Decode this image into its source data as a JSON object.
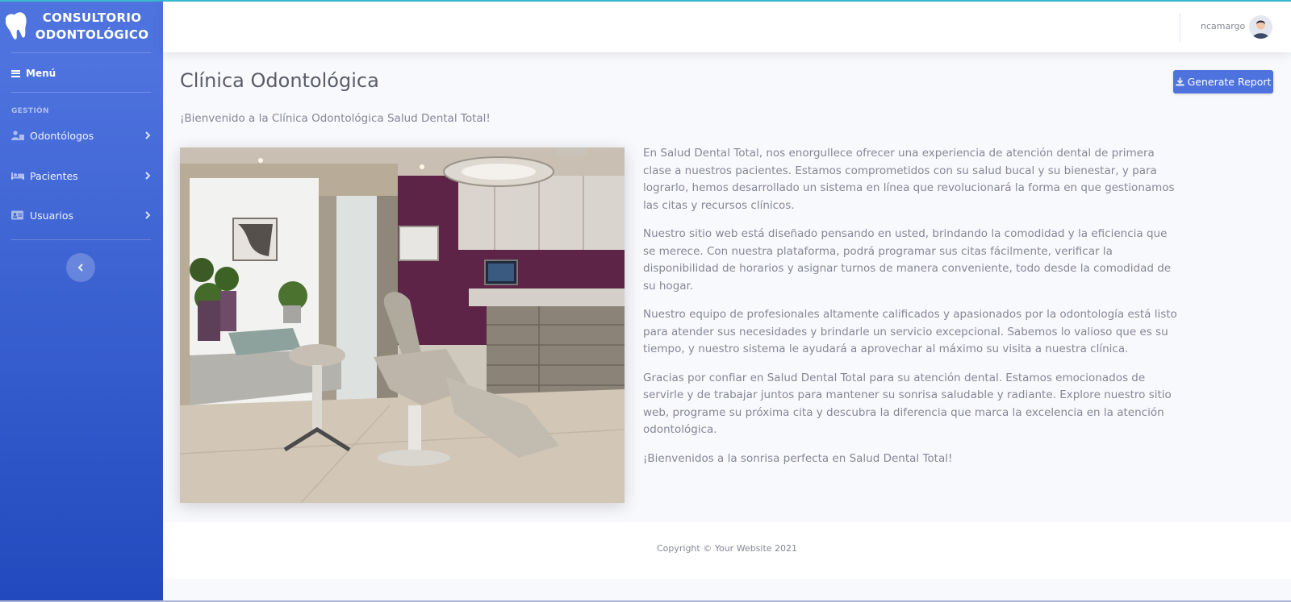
{
  "brand": {
    "line1": "CONSULTORIO",
    "line2": "ODONTOLÓGICO",
    "icon": "tooth-icon"
  },
  "sidebar": {
    "toggle_label": "Menú",
    "heading": "GESTIÓN",
    "items": [
      {
        "label": "Odontólogos",
        "icon": "user-doctor-icon"
      },
      {
        "label": "Pacientes",
        "icon": "bed-icon"
      },
      {
        "label": "Usuarios",
        "icon": "id-card-icon"
      }
    ],
    "collapse_icon": "chevron-left-icon"
  },
  "topbar": {
    "username": "ncamargo"
  },
  "main": {
    "title": "Clínica Odontológica",
    "report_button": "Generate Report",
    "welcome": "¡Bienvenido a la Clínica Odontológica Salud Dental Total!",
    "paragraphs": [
      "En Salud Dental Total, nos enorgullece ofrecer una experiencia de atención dental de primera clase a nuestros pacientes. Estamos comprometidos con su salud bucal y su bienestar, y para lograrlo, hemos desarrollado un sistema en línea que revolucionará la forma en que gestionamos las citas y recursos clínicos.",
      "Nuestro sitio web está diseñado pensando en usted, brindando la comodidad y la eficiencia que se merece. Con nuestra plataforma, podrá programar sus citas fácilmente, verificar la disponibilidad de horarios y asignar turnos de manera conveniente, todo desde la comodidad de su hogar.",
      "Nuestro equipo de profesionales altamente calificados y apasionados por la odontología está listo para atender sus necesidades y brindarle un servicio excepcional. Sabemos lo valioso que es su tiempo, y nuestro sistema le ayudará a aprovechar al máximo su visita a nuestra clínica.",
      "Gracias por confiar en Salud Dental Total para su atención dental. Estamos emocionados de servirle y de trabajar juntos para mantener su sonrisa saludable y radiante. Explore nuestro sitio web, programe su próxima cita y descubra la diferencia que marca la excelencia en la atención odontológica.",
      "¡Bienvenidos a la sonrisa perfecta en Salud Dental Total!"
    ]
  },
  "footer": {
    "copyright": "Copyright © Your Website 2021"
  },
  "colors": {
    "primary": "#4e73df",
    "sidebar_end": "#224abe",
    "text": "#858796",
    "title": "#5a5c69"
  }
}
